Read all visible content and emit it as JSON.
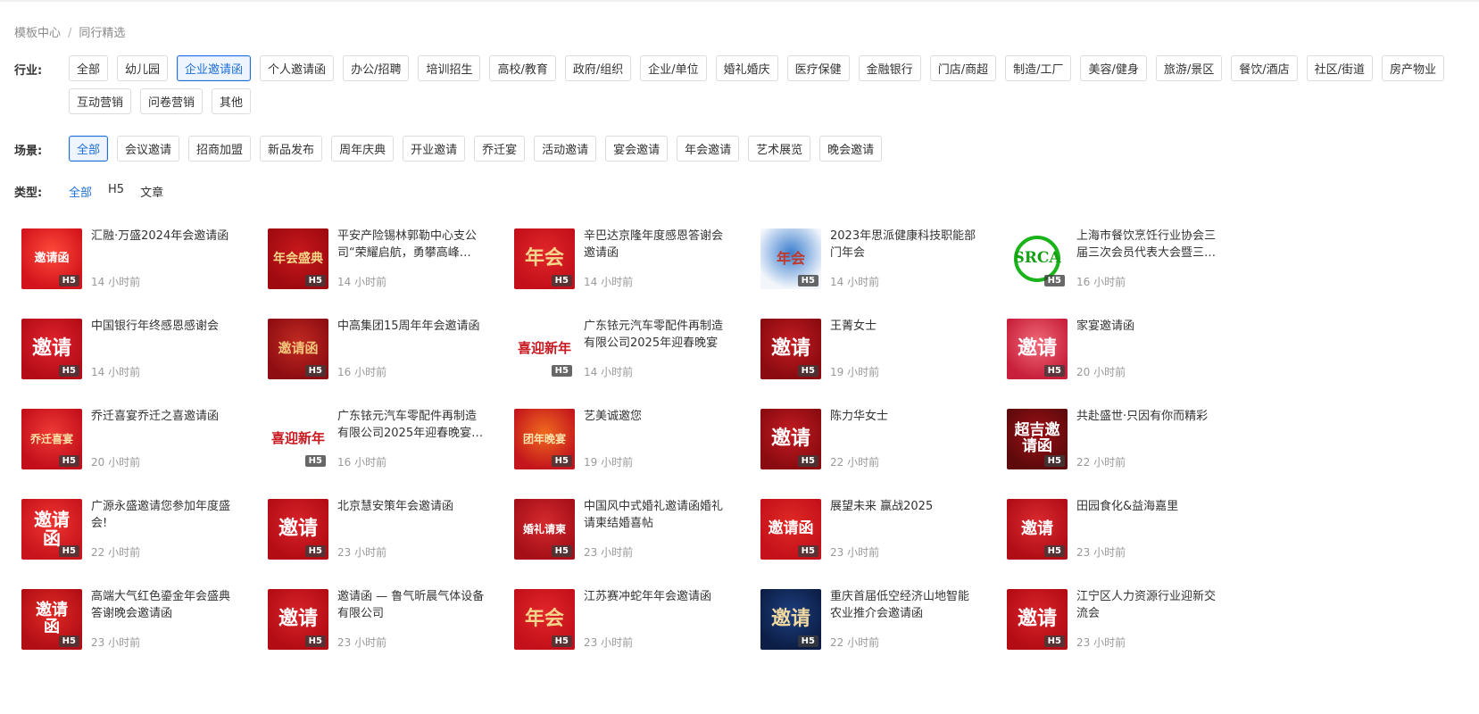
{
  "breadcrumb": {
    "home": "模板中心",
    "separator": "/",
    "current": "同行精选"
  },
  "filters": {
    "industry": {
      "label": "行业:",
      "options": [
        "全部",
        "幼儿园",
        "企业邀请函",
        "个人邀请函",
        "办公/招聘",
        "培训招生",
        "高校/教育",
        "政府/组织",
        "企业/单位",
        "婚礼婚庆",
        "医疗保健",
        "金融银行",
        "门店/商超",
        "制造/工厂",
        "美容/健身",
        "旅游/景区",
        "餐饮/酒店",
        "社区/街道",
        "房产物业",
        "互动营销",
        "问卷营销",
        "其他"
      ],
      "selected": "企业邀请函"
    },
    "scene": {
      "label": "场景:",
      "options": [
        "全部",
        "会议邀请",
        "招商加盟",
        "新品发布",
        "周年庆典",
        "开业邀请",
        "乔迁宴",
        "活动邀请",
        "宴会邀请",
        "年会邀请",
        "艺术展览",
        "晚会邀请"
      ],
      "selected": "全部"
    },
    "type": {
      "label": "类型:",
      "options": [
        "全部",
        "H5",
        "文章"
      ],
      "selected": "全部"
    }
  },
  "colors": {
    "accent": "#1e6fd9",
    "tag_border": "#dcdcdc",
    "muted_text": "#999999"
  },
  "templates": [
    {
      "title": "汇融·万盛2024年会邀请函",
      "time": "14 小时前",
      "badge": "H5",
      "thumb_text": "邀请函",
      "bg": "#d3141c",
      "bg2": "#ff4a3a",
      "fg": "#ffffff",
      "fs": "13px"
    },
    {
      "title": "平安产险锡林郭勒中心支公司“荣耀启航，勇攀高峰…",
      "time": "14 小时前",
      "badge": "H5",
      "thumb_text": "年会盛典",
      "bg": "#9e0a10",
      "bg2": "#c8181c",
      "fg": "#f6d98a",
      "fs": "14px"
    },
    {
      "title": "辛巴达京隆年度感恩答谢会邀请函",
      "time": "14 小时前",
      "badge": "H5",
      "thumb_text": "年会",
      "bg": "#c4101a",
      "bg2": "#e0262a",
      "fg": "#f5d58b",
      "fs": "22px"
    },
    {
      "title": "2023年思派健康科技职能部门年会",
      "time": "14 小时前",
      "badge": "H5",
      "thumb_text": "年会",
      "bg": "#f2f6fb",
      "bg2": "#3d7fcf",
      "fg": "#c0392b",
      "fs": "16px"
    },
    {
      "title": "上海市餐饮烹饪行业协会三届三次会员代表大会暨三…",
      "time": "16 小时前",
      "badge": "H5",
      "thumb_text": "SRCA",
      "bg": "#ffffff",
      "bg2": "#ffffff",
      "fg": "#16a016",
      "fs": "17px",
      "ring": "#1ab31a"
    },
    {
      "title": "中国银行年终感恩感谢会",
      "time": "14 小时前",
      "badge": "H5",
      "thumb_text": "邀请",
      "bg": "#b50d18",
      "bg2": "#e0232d",
      "fg": "#ffffff",
      "fs": "22px"
    },
    {
      "title": "中高集团15周年年会邀请函",
      "time": "16 小时前",
      "badge": "H5",
      "thumb_text": "邀请函",
      "bg": "#8e0d12",
      "bg2": "#c12a22",
      "fg": "#f2c47a",
      "fs": "15px"
    },
    {
      "title": "广东铱元汽车零配件再制造有限公司2025年迎春晚宴",
      "time": "14 小时前",
      "badge": "H5",
      "thumb_text": "喜迎新年",
      "bg": "#ffffff",
      "bg2": "#ffffff",
      "fg": "#c81820",
      "fs": "15px"
    },
    {
      "title": "王菁女士",
      "time": "19 小时前",
      "badge": "H5",
      "thumb_text": "邀请",
      "bg": "#8a0b10",
      "bg2": "#c31c22",
      "fg": "#ffffff",
      "fs": "22px"
    },
    {
      "title": "家宴邀请函",
      "time": "20 小时前",
      "badge": "H5",
      "thumb_text": "邀请",
      "bg": "#c8203c",
      "bg2": "#f06a78",
      "fg": "#ffffff",
      "fs": "22px"
    },
    {
      "title": "乔迁喜宴乔迁之喜邀请函",
      "time": "20 小时前",
      "badge": "H5",
      "thumb_text": "乔迁喜宴",
      "bg": "#c30f1a",
      "bg2": "#ef3a36",
      "fg": "#fbe3a6",
      "fs": "12px"
    },
    {
      "title": "广东铱元汽车零配件再制造有限公司2025年迎春晚宴…",
      "time": "16 小时前",
      "badge": "H5",
      "thumb_text": "喜迎新年",
      "bg": "#ffffff",
      "bg2": "#ffffff",
      "fg": "#c81820",
      "fs": "15px"
    },
    {
      "title": "艺美诚邀您",
      "time": "19 小时前",
      "badge": "H5",
      "thumb_text": "团年晚宴",
      "bg": "#c4161c",
      "bg2": "#f06a1e",
      "fg": "#fde6b0",
      "fs": "12px"
    },
    {
      "title": "陈力华女士",
      "time": "22 小时前",
      "badge": "H5",
      "thumb_text": "邀请",
      "bg": "#8a0b10",
      "bg2": "#c31c22",
      "fg": "#ffffff",
      "fs": "22px"
    },
    {
      "title": "共赴盛世·只因有你而精彩",
      "time": "22 小时前",
      "badge": "H5",
      "thumb_text": "超吉邀请函",
      "bg": "#5e0a0c",
      "bg2": "#9b1016",
      "fg": "#ffffff",
      "fs": "17px"
    },
    {
      "title": "广源永盛邀请您参加年度盛会!",
      "time": "22 小时前",
      "badge": "H5",
      "thumb_text": "邀请函",
      "bg": "#c8141c",
      "bg2": "#ee3530",
      "fg": "#ffffff",
      "fs": "20px"
    },
    {
      "title": "北京慧安策年会邀请函",
      "time": "23 小时前",
      "badge": "H5",
      "thumb_text": "邀请",
      "bg": "#b40c14",
      "bg2": "#d8232a",
      "fg": "#ffffff",
      "fs": "22px"
    },
    {
      "title": "中国风中式婚礼邀请函婚礼请柬结婚喜帖",
      "time": "23 小时前",
      "badge": "H5",
      "thumb_text": "婚礼请柬",
      "bg": "#a60f18",
      "bg2": "#d42a2e",
      "fg": "#ffffff",
      "fs": "12px"
    },
    {
      "title": "展望未来 赢战2025",
      "time": "23 小时前",
      "badge": "H5",
      "thumb_text": "邀请函",
      "bg": "#c4111a",
      "bg2": "#e02a26",
      "fg": "#ffffff",
      "fs": "17px"
    },
    {
      "title": "田园食化&益海嘉里",
      "time": "23 小时前",
      "badge": "H5",
      "thumb_text": "邀请",
      "bg": "#b10d17",
      "bg2": "#db2b30",
      "fg": "#ffffff",
      "fs": "18px"
    },
    {
      "title": "高端大气红色鎏金年会盛典答谢晚会邀请函",
      "time": "23 小时前",
      "badge": "H5",
      "thumb_text": "邀请函",
      "bg": "#b20e16",
      "bg2": "#e02a24",
      "fg": "#ffffff",
      "fs": "18px"
    },
    {
      "title": "邀请函 — 鲁气昕晨气体设备有限公司",
      "time": "23 小时前",
      "badge": "H5",
      "thumb_text": "邀请",
      "bg": "#b40c14",
      "bg2": "#d8232a",
      "fg": "#ffffff",
      "fs": "22px"
    },
    {
      "title": "江苏赛冲蛇年年会邀请函",
      "time": "23 小时前",
      "badge": "H5",
      "thumb_text": "年会",
      "bg": "#c4101a",
      "bg2": "#e0262a",
      "fg": "#f5d58b",
      "fs": "22px"
    },
    {
      "title": "重庆首届低空经济山地智能农业推介会邀请函",
      "time": "22 小时前",
      "badge": "H5",
      "thumb_text": "邀请",
      "bg": "#0c1e46",
      "bg2": "#1d3f7f",
      "fg": "#f2d9a0",
      "fs": "22px"
    },
    {
      "title": "江宁区人力资源行业迎新交流会",
      "time": "23 小时前",
      "badge": "H5",
      "thumb_text": "邀请",
      "bg": "#b40c14",
      "bg2": "#d8232a",
      "fg": "#ffffff",
      "fs": "22px"
    }
  ]
}
